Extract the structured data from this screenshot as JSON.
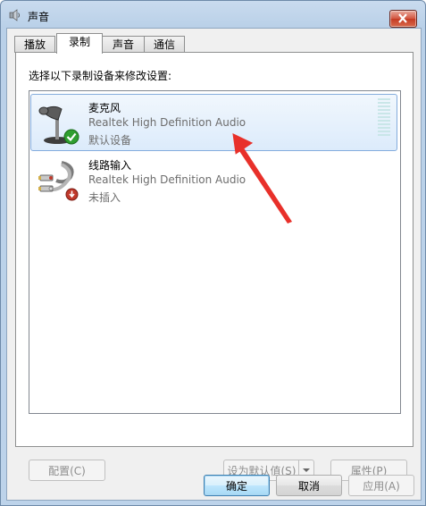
{
  "window": {
    "title": "声音",
    "title_icon": "speaker-icon",
    "close_icon": "close-icon"
  },
  "tabs": [
    {
      "label": "播放",
      "active": false
    },
    {
      "label": "录制",
      "active": true
    },
    {
      "label": "声音",
      "active": false
    },
    {
      "label": "通信",
      "active": false
    }
  ],
  "instruction": "选择以下录制设备来修改设置:",
  "devices": [
    {
      "name": "麦克风",
      "driver": "Realtek High Definition Audio",
      "status": "默认设备",
      "icon": "microphone-icon",
      "badge": "default-check-icon",
      "selected": true
    },
    {
      "name": "线路输入",
      "driver": "Realtek High Definition Audio",
      "status": "未插入",
      "icon": "line-in-cable-icon",
      "badge": "unplugged-icon",
      "selected": false
    }
  ],
  "panel_buttons": {
    "configure": "配置(C)",
    "set_default": "设为默认值(S)",
    "properties": "属性(P)"
  },
  "dialog_buttons": {
    "ok": "确定",
    "cancel": "取消",
    "apply": "应用(A)"
  },
  "colors": {
    "selection": "#dcebfb",
    "accent": "#3c7fb1",
    "annotation_arrow": "#e8302a",
    "close": "#c43a23"
  }
}
